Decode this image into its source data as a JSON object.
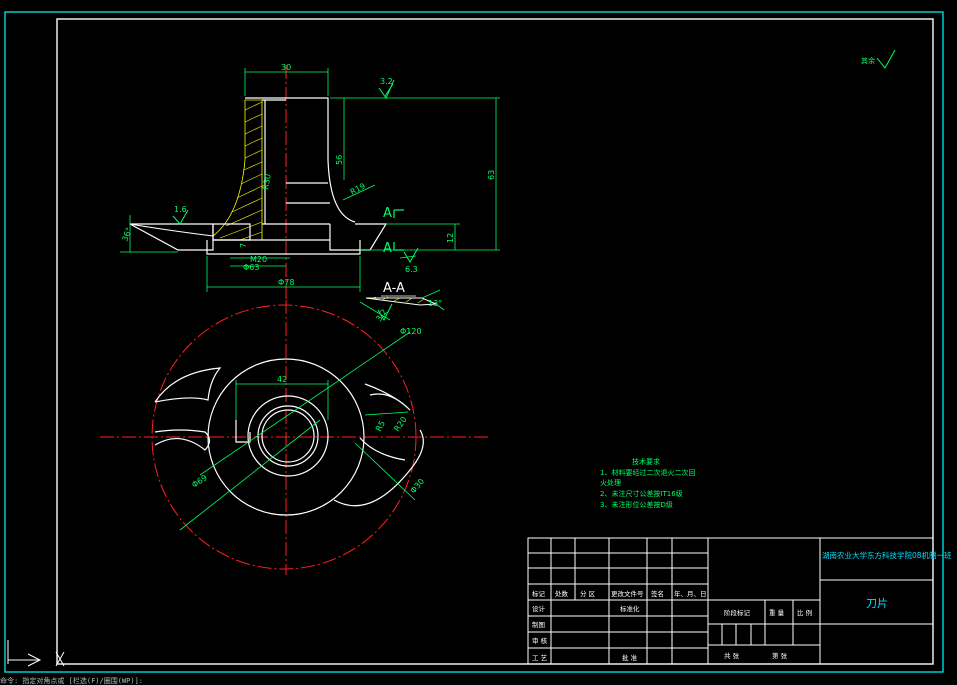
{
  "drawing": {
    "roughness_note": "其余",
    "roughness_global": "6.3",
    "section_label_top": "A",
    "section_label_bottom": "A",
    "section_view_title": "A-A"
  },
  "dimensions": {
    "top_width": "30",
    "surface_roughness_top": "3.2",
    "height_56": "56",
    "total_height": "63",
    "flange_height": "12",
    "r19": "R19",
    "r30": "R30",
    "roughness_left": "1.6",
    "angle_left": "36°",
    "seven": "7",
    "thread": "M20",
    "dia_63": "Φ63",
    "dia_78": "Φ78",
    "roughness_bottom": "6.3",
    "angle_section": "13°",
    "roughness_section": "3.2",
    "dia_120": "Φ120",
    "width_42": "42",
    "dia_69": "Φ69",
    "r_20": "R20",
    "r_55": "R5",
    "dia_30": "Φ30"
  },
  "tech_requirements": {
    "title": "技术要求",
    "lines": [
      "1、材料要经过二次退火二次回",
      "火处理",
      "2、未注尺寸公差按IT16级",
      "3、未注形位公差按D级"
    ]
  },
  "title_block": {
    "school": "湖南农业大学东方科技学院08机制一班",
    "part_name": "刀片",
    "row_marks": [
      "标记",
      "处数",
      "分 区",
      "更改文件号",
      "签名",
      "年、月、日"
    ],
    "design": "设计",
    "standardize": "标准化",
    "drawing": "制图",
    "review": "审 核",
    "process": "工 艺",
    "approve": "批 准",
    "stage_mark": "阶段标记",
    "weight": "重 量",
    "scale": "比 例",
    "sheets_total": "共    张",
    "sheet_no": "第    张"
  },
  "command_line": "命令: 指定对角点或 [栏选(F)/圈围(WP)]:",
  "colors": {
    "background": "#000000",
    "frame": "#ffffff",
    "border": "#00ffff",
    "dimension": "#00ff66",
    "center": "#ff2020",
    "hatch": "#ffff00",
    "outline": "#ffffff",
    "title_block_text": "#00e0ff"
  }
}
